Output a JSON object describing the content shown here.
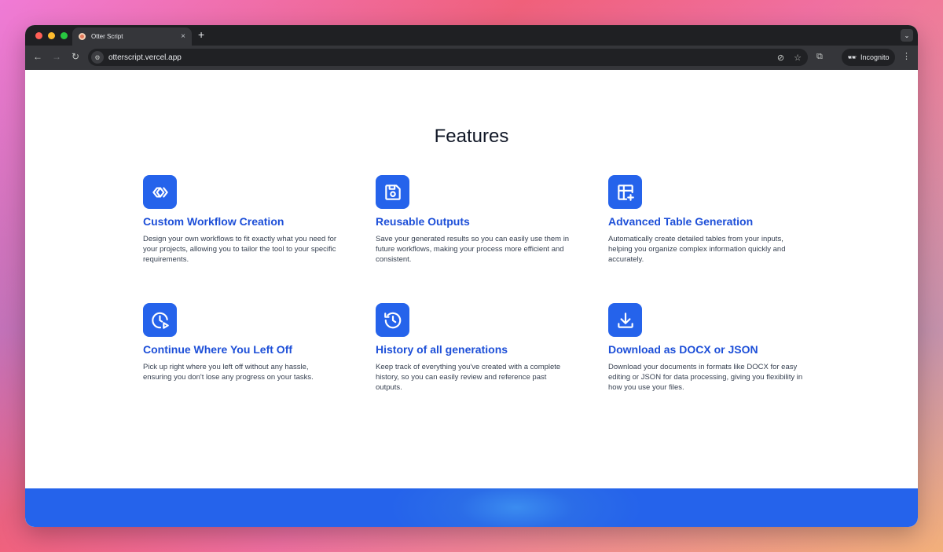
{
  "browser": {
    "tab_title": "Otter Script",
    "tab_close": "×",
    "new_tab": "+",
    "url": "otterscript.vercel.app",
    "incognito_label": "Incognito"
  },
  "page": {
    "title": "Features",
    "features": [
      {
        "icon": "double-chevron-icon",
        "title": "Custom Workflow Creation",
        "description": "Design your own workflows to fit exactly what you need for your projects, allowing you to tailor the tool to your specific requirements."
      },
      {
        "icon": "save-disk-icon",
        "title": "Reusable Outputs",
        "description": "Save your generated results so you can easily use them in future workflows, making your process more efficient and consistent."
      },
      {
        "icon": "table-plus-icon",
        "title": "Advanced Table Generation",
        "description": "Automatically create detailed tables from your inputs, helping you organize complex information quickly and accurately."
      },
      {
        "icon": "clock-play-icon",
        "title": "Continue Where You Left Off",
        "description": "Pick up right where you left off without any hassle, ensuring you don't lose any progress on your tasks."
      },
      {
        "icon": "history-icon",
        "title": "History of all generations",
        "description": "Keep track of everything you've created with a complete history, so you can easily review and reference past outputs."
      },
      {
        "icon": "download-icon",
        "title": "Download as DOCX or JSON",
        "description": "Download your documents in formats like DOCX for easy editing or JSON for data processing, giving you flexibility in how you use your files."
      }
    ]
  },
  "colors": {
    "accent": "#2563eb",
    "feature_title": "#1d4fd8",
    "body_text": "#374151"
  }
}
